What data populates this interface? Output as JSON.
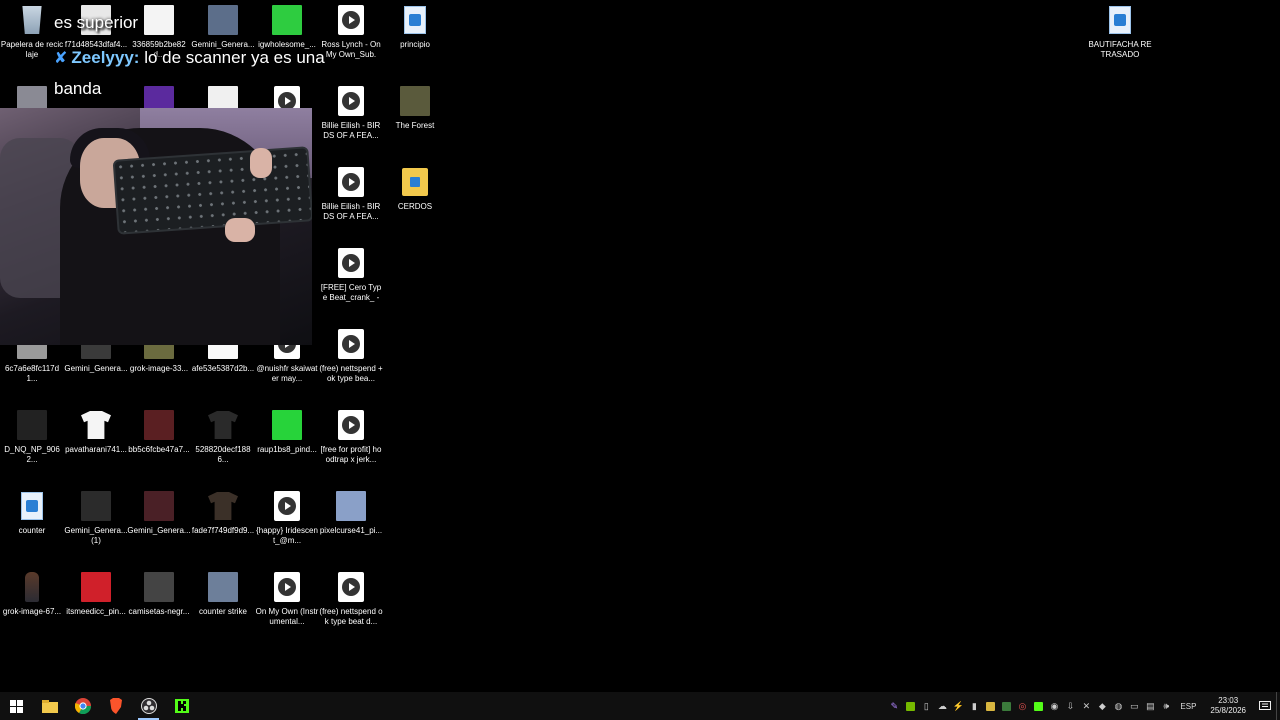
{
  "desktop_icons": [
    {
      "label": "Papelera de reciclaje",
      "kind": "recycle"
    },
    {
      "label": "f71d48543dfaf4...",
      "kind": "image",
      "color": "#e8e8e8"
    },
    {
      "label": "336859b2be82d...",
      "kind": "image",
      "color": "#f4f4f4"
    },
    {
      "label": "Gemini_Genera...",
      "kind": "image",
      "color": "#5c6e8a"
    },
    {
      "label": "igwholesome_...",
      "kind": "image",
      "color": "#2ecc40"
    },
    {
      "label": "Ross Lynch - On My Own_Sub. E...",
      "kind": "media"
    },
    {
      "label": "principio",
      "kind": "doc"
    },
    {
      "label": "",
      "kind": "image",
      "color": "#8a8a94"
    },
    {
      "label": "",
      "kind": "image",
      "color": "#5b2a9e"
    },
    {
      "label": "",
      "kind": "image",
      "color": "#f0f0f0"
    },
    {
      "label": "",
      "kind": "media"
    },
    {
      "label": "Billie Eilish - BIRDS OF A FEA...",
      "kind": "media"
    },
    {
      "label": "The Forest",
      "kind": "image",
      "color": "#5a5a3c"
    },
    {
      "label": "Billie Eilish - BIRDS OF A FEA...",
      "kind": "media"
    },
    {
      "label": "CERDOS",
      "kind": "folder"
    },
    {
      "label": "[FREE] Cero Type Beat_crank_ - I...",
      "kind": "media"
    },
    {
      "label": "6c7a6e8fc117d1...",
      "kind": "image",
      "color": "#9a9a9a"
    },
    {
      "label": "Gemini_Genera...",
      "kind": "image",
      "color": "#3a3a3a"
    },
    {
      "label": "grok-image-33...",
      "kind": "image",
      "color": "#6b6b3f"
    },
    {
      "label": "afe53e5387d2b...",
      "kind": "image",
      "color": "#fafafa"
    },
    {
      "label": "@nuishfr skaiwater may...",
      "kind": "media"
    },
    {
      "label": "(free) nettspend + ok type bea...",
      "kind": "media"
    },
    {
      "label": "D_NQ_NP_9062...",
      "kind": "image",
      "color": "#222"
    },
    {
      "label": "pavatharani741...",
      "kind": "shirt",
      "color": "#f5f5f5"
    },
    {
      "label": "bb5c6fcbe47a7...",
      "kind": "image",
      "color": "#5a1f22"
    },
    {
      "label": "528820decf1886...",
      "kind": "shirt",
      "color": "#2a2a2a"
    },
    {
      "label": "raup1bs8_pind...",
      "kind": "image",
      "color": "#27d33a"
    },
    {
      "label": "[free for profit] hoodtrap x jerk...",
      "kind": "media"
    },
    {
      "label": "counter",
      "kind": "doc"
    },
    {
      "label": "Gemini_Genera... (1)",
      "kind": "image",
      "color": "#2b2b2b"
    },
    {
      "label": "Gemini_Genera...",
      "kind": "image",
      "color": "#4a2026"
    },
    {
      "label": "fade7f749df9d9...",
      "kind": "shirt",
      "color": "#3b3028"
    },
    {
      "label": "{happy} Iridescent_@m...",
      "kind": "media"
    },
    {
      "label": "pixelcurse41_pi...",
      "kind": "image",
      "color": "#8aa0c8"
    },
    {
      "label": "grok-image-67...",
      "kind": "figure"
    },
    {
      "label": "itsmeedicc_pin...",
      "kind": "image",
      "color": "#d0202a"
    },
    {
      "label": "camisetas-negr...",
      "kind": "image",
      "color": "#444"
    },
    {
      "label": "counter strike",
      "kind": "image",
      "color": "#6d7f9a"
    },
    {
      "label": "On My Own (Instrumental...",
      "kind": "media"
    },
    {
      "label": "(free) nettspend ok type beat d...",
      "kind": "media"
    },
    {
      "label": "BAUTIFACHA RETRASADO",
      "kind": "doc"
    }
  ],
  "chat": {
    "line1": "es superior",
    "user": "Zeelyyy:",
    "message": "lo de scanner ya es una",
    "line3": "banda"
  },
  "taskbar": {
    "apps": [
      "start",
      "file-explorer",
      "chrome",
      "brave",
      "obs",
      "kick"
    ],
    "language": "ESP",
    "time": "23:03",
    "date": "25/8/2026"
  },
  "colors": {
    "taskbar_bg": "#101010",
    "kick_green": "#53fc18",
    "brave_orange": "#fb542b"
  }
}
